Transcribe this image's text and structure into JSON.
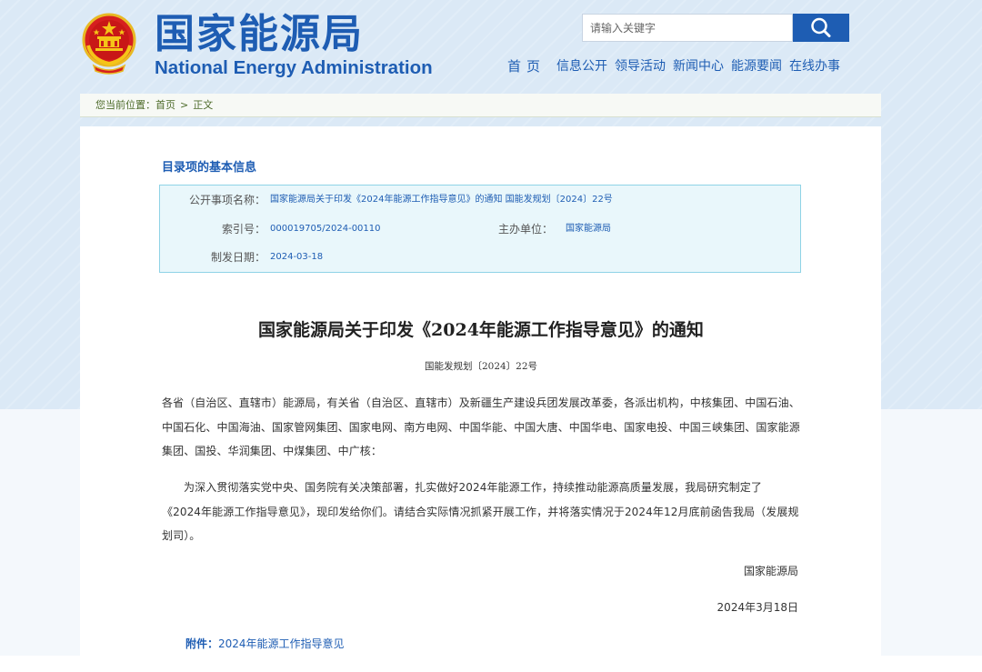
{
  "header": {
    "title_cn": "国家能源局",
    "title_en": "National Energy Administration",
    "search": {
      "placeholder": "请输入关键字"
    },
    "nav": [
      "首页",
      "信息公开",
      "领导活动",
      "新闻中心",
      "能源要闻",
      "在线办事"
    ]
  },
  "breadcrumb": {
    "prefix": "您当前位置：",
    "home": "首页",
    "separator": ">",
    "current": "正文"
  },
  "info": {
    "title": "目录项的基本信息",
    "name_label": "公开事项名称：",
    "name_value": "国家能源局关于印发《2024年能源工作指导意见》的通知 国能发规划〔2024〕22号",
    "index_label": "索引号：",
    "index_value": "000019705/2024-00110",
    "org_label": "主办单位：",
    "org_value": "国家能源局",
    "date_label": "制发日期：",
    "date_value": "2024-03-18"
  },
  "document": {
    "title": "国家能源局关于印发《2024年能源工作指导意见》的通知",
    "number": "国能发规划〔2024〕22号",
    "recipients": "各省（自治区、直辖市）能源局，有关省（自治区、直辖市）及新疆生产建设兵团发展改革委，各派出机构，中核集团、中国石油、中国石化、中国海油、国家管网集团、国家电网、南方电网、中国华能、中国大唐、中国华电、国家电投、中国三峡集团、国家能源集团、国投、华润集团、中煤集团、中广核：",
    "body": "为深入贯彻落实党中央、国务院有关决策部署，扎实做好2024年能源工作，持续推动能源高质量发展，我局研究制定了《2024年能源工作指导意见》，现印发给你们。请结合实际情况抓紧开展工作，并将落实情况于2024年12月底前函告我局（发展规划司）。",
    "signature": "国家能源局",
    "date": "2024年3月18日",
    "attachment_label": "附件：",
    "attachment_link": "2024年能源工作指导意见"
  },
  "colors": {
    "brand_blue": "#1e5db3",
    "info_bg": "#e9f7fb",
    "info_border": "#8fd3e6"
  }
}
